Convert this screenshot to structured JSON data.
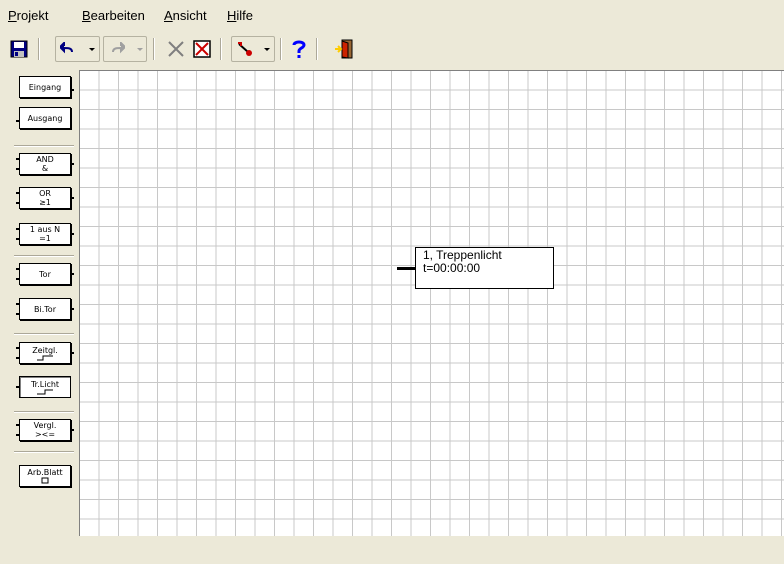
{
  "menu": {
    "projekt": {
      "accel": "P",
      "rest": "rojekt"
    },
    "bearbeiten": {
      "accel": "B",
      "rest": "earbeiten"
    },
    "ansicht": {
      "accel": "A",
      "rest": "nsicht"
    },
    "hilfe": {
      "accel": "H",
      "rest": "ilfe"
    }
  },
  "toolbar": {
    "icons": [
      "floppy-disk-save-icon",
      "undo-icon",
      "redo-icon",
      "cut-icon",
      "delete-icon",
      "pin-tool-icon",
      "help-icon",
      "exit-door-icon"
    ],
    "colors": {
      "save": "#000080",
      "help": "#0000ff",
      "exit": "#cc2200",
      "cut": "#7f7f7f",
      "delete": "#cc0000"
    }
  },
  "palette": [
    {
      "lines": [
        "Eingang"
      ]
    },
    {
      "lines": [
        "Ausgang"
      ]
    },
    {
      "lines": [
        "AND",
        "&"
      ]
    },
    {
      "lines": [
        "OR",
        "≥1"
      ]
    },
    {
      "lines": [
        "1 aus N",
        "=1"
      ]
    },
    {
      "lines": [
        "Tor"
      ]
    },
    {
      "lines": [
        "Bi.Tor"
      ]
    },
    {
      "lines": [
        "Zeitgl."
      ]
    },
    {
      "lines": [
        "Tr.Licht"
      ]
    },
    {
      "lines": [
        "Vergl.",
        "><="
      ]
    },
    {
      "lines": [
        "Arb.Blatt"
      ]
    }
  ],
  "canvas": {
    "node": {
      "title": "1, Treppenlicht",
      "time": "t=00:00:00"
    }
  }
}
